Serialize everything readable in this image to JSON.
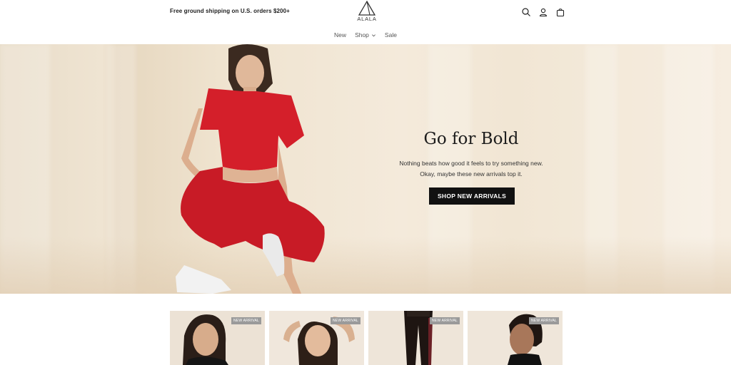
{
  "header": {
    "promo": "Free ground shipping on U.S. orders $200+",
    "logo_text": "ALALA",
    "icons": [
      "search-icon",
      "account-icon",
      "cart-icon"
    ]
  },
  "nav": {
    "items": [
      {
        "label": "New"
      },
      {
        "label": "Shop",
        "has_dropdown": true
      },
      {
        "label": "Sale"
      }
    ]
  },
  "hero": {
    "title": "Go for Bold",
    "subtitle": "Nothing beats how good it feels to try something new. Okay, maybe these new arrivals top it.",
    "cta": "SHOP NEW ARRIVALS"
  },
  "products": [
    {
      "badge": "NEW ARRIVAL"
    },
    {
      "badge": "NEW ARRIVAL"
    },
    {
      "badge": "NEW ARRIVAL"
    },
    {
      "badge": "NEW ARRIVAL"
    }
  ],
  "colors": {
    "accent_button": "#111111",
    "hero_background": "#efe4d2",
    "outfit": "#d41f2a"
  }
}
